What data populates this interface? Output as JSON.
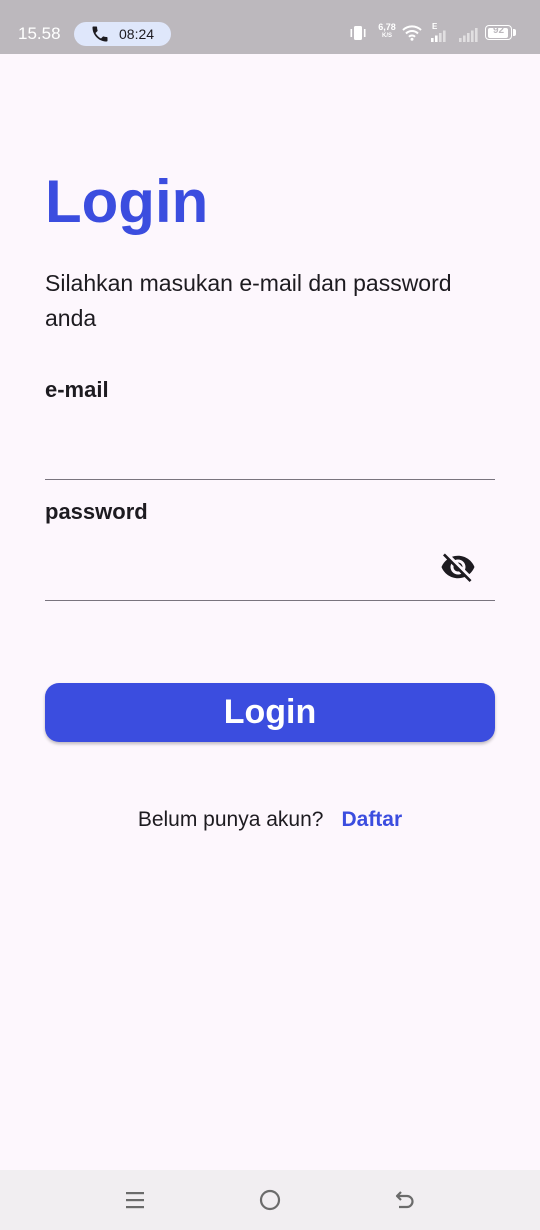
{
  "status_bar": {
    "time": "15.58",
    "call_duration": "08:24",
    "net_speed_value": "6,78",
    "net_speed_unit": "K/S",
    "network_type": "E",
    "battery_percent": 92
  },
  "login": {
    "title": "Login",
    "subtitle": "Silahkan masukan e-mail dan password anda",
    "email_label": "e-mail",
    "email_value": "",
    "password_label": "password",
    "password_value": "",
    "password_visibility_icon": "visibility-off-icon",
    "submit_label": "Login"
  },
  "register": {
    "prompt": "Belum punya akun?",
    "link_label": "Daftar"
  },
  "nav_bar": {
    "icons": [
      "menu-icon",
      "home-icon",
      "back-icon"
    ]
  },
  "colors": {
    "accent": "#3b4ddf",
    "background": "#fdf7fd",
    "status_bar": "#bcb8bd",
    "nav_bar": "#f1eef1",
    "text": "#1d1b20",
    "field_underline": "#79747e"
  }
}
